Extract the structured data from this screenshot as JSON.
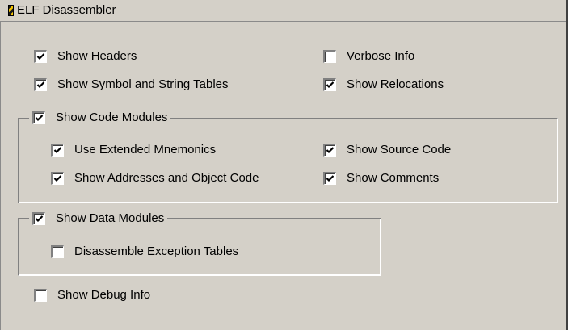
{
  "window": {
    "title": "ELF Disassembler"
  },
  "options": {
    "show_headers": {
      "label": "Show Headers",
      "checked": true
    },
    "verbose_info": {
      "label": "Verbose Info",
      "checked": false
    },
    "show_symbol_tables": {
      "label": "Show Symbol and String Tables",
      "checked": true
    },
    "show_relocations": {
      "label": "Show Relocations",
      "checked": true
    },
    "show_debug_info": {
      "label": "Show Debug Info",
      "checked": false
    }
  },
  "code_modules": {
    "label": "Show Code Modules",
    "checked": true,
    "items": {
      "use_extended_mnemonics": {
        "label": "Use Extended Mnemonics",
        "checked": true
      },
      "show_source_code": {
        "label": "Show Source Code",
        "checked": true
      },
      "show_addresses": {
        "label": "Show Addresses and Object Code",
        "checked": true
      },
      "show_comments": {
        "label": "Show Comments",
        "checked": true
      }
    }
  },
  "data_modules": {
    "label": "Show Data Modules",
    "checked": true,
    "items": {
      "disassemble_exception_tables": {
        "label": "Disassemble Exception Tables",
        "checked": false
      }
    }
  }
}
